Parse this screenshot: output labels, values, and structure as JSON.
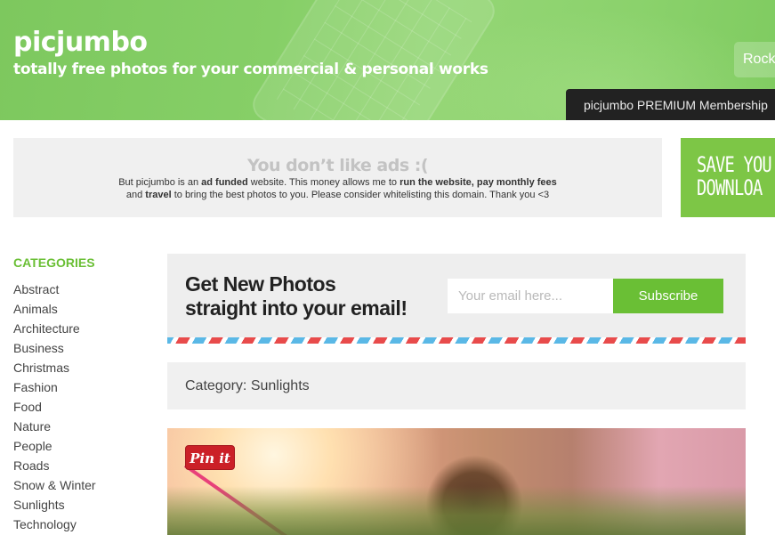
{
  "header": {
    "title": "picjumbo",
    "tagline": "totally free photos for your commercial & personal works",
    "rock_button": "Rock",
    "premium_label": "picjumbo PREMIUM Membership",
    "accent_color": "#7dc85e"
  },
  "ad": {
    "title": "You don’t like ads :(",
    "line1_a": "But picjumbo is an ",
    "line1_b": "ad funded",
    "line1_c": " website. This money allows me to ",
    "line1_d": "run the website",
    "line1_e": ", ",
    "line1_f": "pay monthly fees",
    "line2_a": "and ",
    "line2_b": "travel",
    "line2_c": " to bring the best photos to you. Please consider whitelisting this domain. Thank you <3",
    "banner_line1": "SAVE YOU",
    "banner_line2": "DOWNLOA"
  },
  "sidebar": {
    "heading": "CATEGORIES",
    "items": [
      {
        "label": "Abstract"
      },
      {
        "label": "Animals"
      },
      {
        "label": "Architecture"
      },
      {
        "label": "Business"
      },
      {
        "label": "Christmas"
      },
      {
        "label": "Fashion"
      },
      {
        "label": "Food"
      },
      {
        "label": "Nature"
      },
      {
        "label": "People"
      },
      {
        "label": "Roads"
      },
      {
        "label": "Snow & Winter"
      },
      {
        "label": "Sunlights"
      },
      {
        "label": "Technology"
      }
    ]
  },
  "newsletter": {
    "title_line1": "Get New Photos",
    "title_line2": "straight into your email!",
    "email_placeholder": "Your email here...",
    "subscribe_label": "Subscribe",
    "button_color": "#6abf35"
  },
  "category_bar": {
    "label": "Category: Sunlights"
  },
  "photo": {
    "pin_label": "Pin it"
  }
}
